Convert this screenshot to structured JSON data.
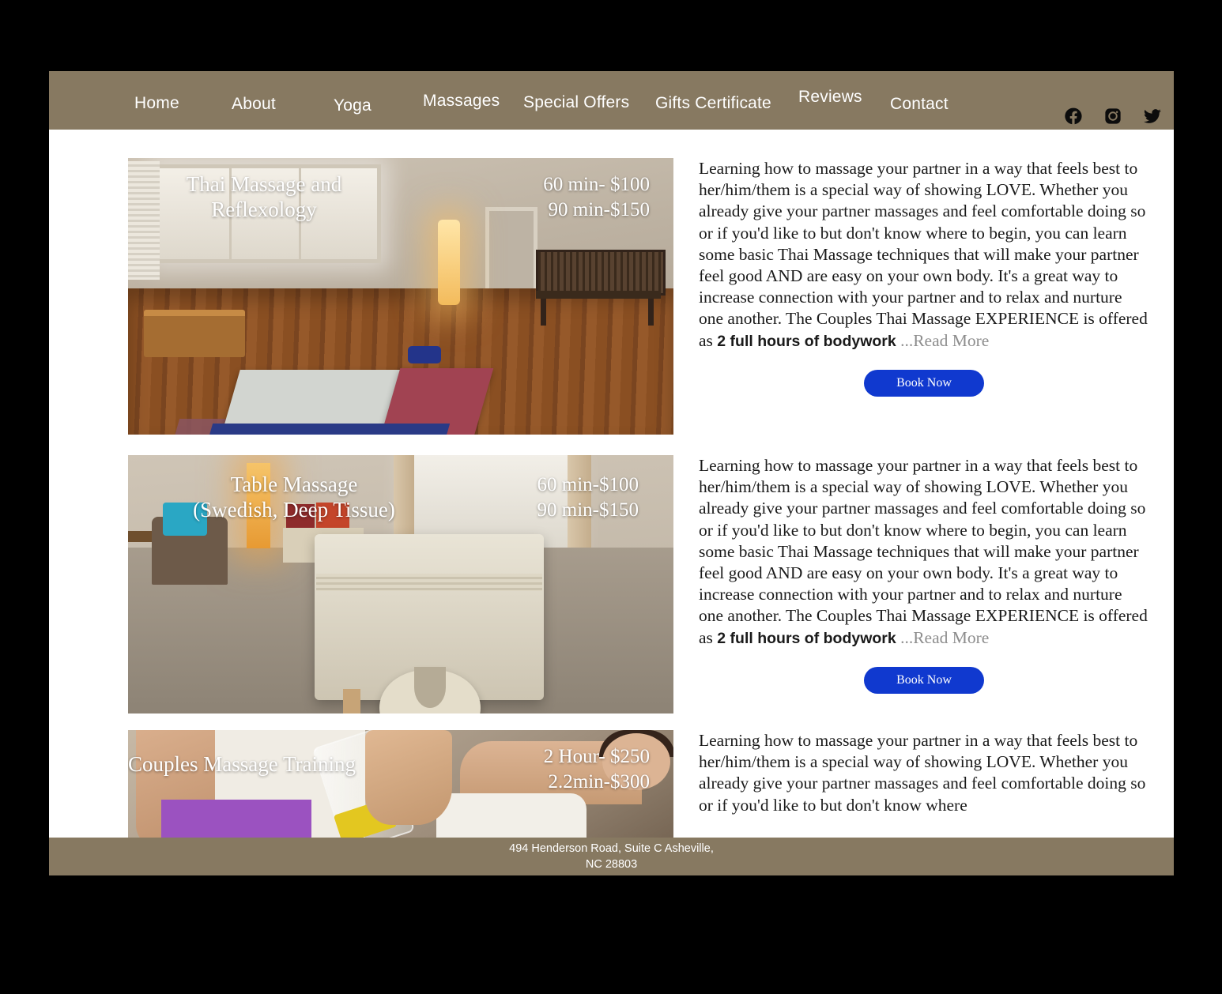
{
  "theme": {
    "header_bg": "#877961",
    "footer_bg": "#877961",
    "page_bg": "#ffffff",
    "outer_bg": "#000000",
    "button_bg": "#1039cf",
    "read_more_color": "#8d8d8d"
  },
  "header": {
    "nav": [
      {
        "label": "Home"
      },
      {
        "label": "About"
      },
      {
        "label": "Yoga"
      },
      {
        "label": "Massages"
      },
      {
        "label": "Special Offers"
      },
      {
        "label": "Gifts Certificate"
      },
      {
        "label": "Reviews"
      },
      {
        "label": "Contact"
      }
    ],
    "socials": [
      {
        "name": "facebook-icon"
      },
      {
        "name": "instagram-icon"
      },
      {
        "name": "twitter-icon"
      }
    ]
  },
  "services": [
    {
      "title": "Thai Massage and\nReflexology",
      "prices": "60 min- $100\n90 min-$150",
      "image_alt": "thai-massage-room",
      "description_part1": "Learning how to massage your partner in a way that feels best to her/him/them is a special way of showing LOVE. Whether you already give your partner massages and feel comfortable doing so or if you'd like to but don't know where to begin, you can learn some basic Thai Massage techniques that will make your partner feel good AND are easy on your own body. It's a great way to increase connection with your partner and to relax and nurture one another. The Couples Thai Massage EXPERIENCE is offered as ",
      "description_bold": "2 full hours of bodywork",
      "read_more": "...Read More",
      "button_label": "Book Now"
    },
    {
      "title": "Table Massage\n(Swedish, Deep Tissue)",
      "prices": "60 min-$100\n90 min-$150",
      "image_alt": "table-massage-room",
      "description_part1": "Learning how to massage your partner in a way that feels best to her/him/them is a special way of showing LOVE. Whether you already give your partner massages and feel comfortable doing so or if you'd like to but don't know where to begin, you can learn some basic Thai Massage techniques that will make your partner feel good AND are easy on your own body. It's a great way to increase connection with your partner and to relax and nurture one another. The Couples Thai Massage EXPERIENCE is offered as ",
      "description_bold": "2 full hours of bodywork",
      "read_more": "...Read More",
      "button_label": "Book Now"
    },
    {
      "title": "Couples Massage Training",
      "prices": "2 Hour- $250\n2.2min-$300",
      "image_alt": "couples-massage-training",
      "description_part1": "Learning how to massage your partner in a way that feels best to her/him/them is a special way of showing LOVE. Whether you already give your partner massages and feel comfortable doing so or if you'd like to but don't know where",
      "description_bold": "",
      "read_more": "",
      "button_label": ""
    }
  ],
  "footer": {
    "address": "494 Henderson Road, Suite C Asheville,\nNC 28803"
  }
}
